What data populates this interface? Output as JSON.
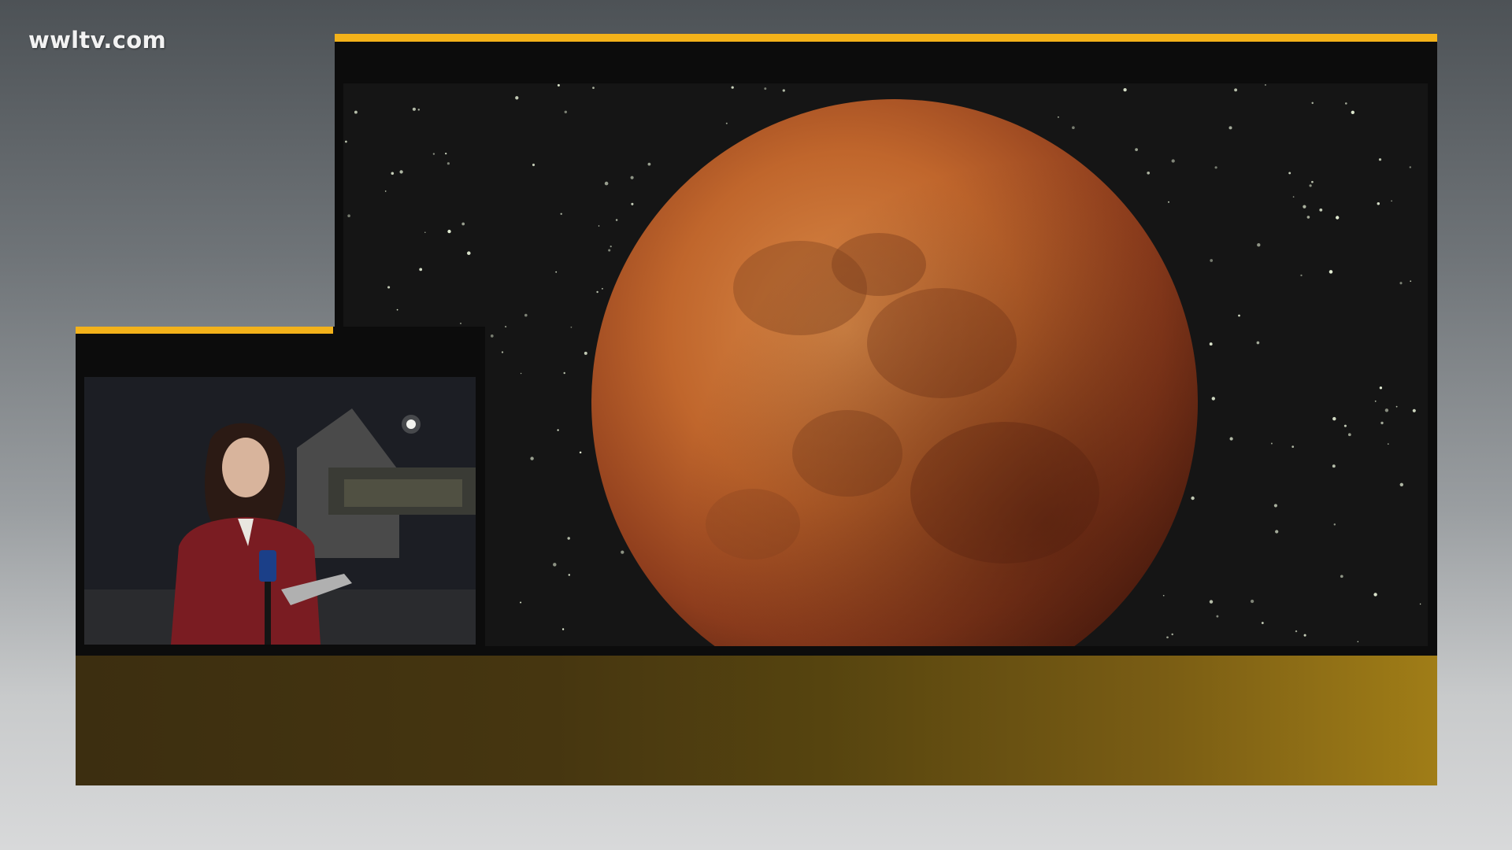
{
  "watermark": {
    "text": "wwltv.com"
  },
  "colors": {
    "accent_gold": "#f3b21a",
    "frame_dark": "#0c0c0c",
    "moon_orange": "#c56a2e",
    "lower_third_start": "#3c2e10",
    "lower_third_end": "#a07d17"
  },
  "main_image": {
    "subject": "lunar-eclipse-blood-moon"
  },
  "inset_video": {
    "subject": "reporter-live-shot"
  }
}
